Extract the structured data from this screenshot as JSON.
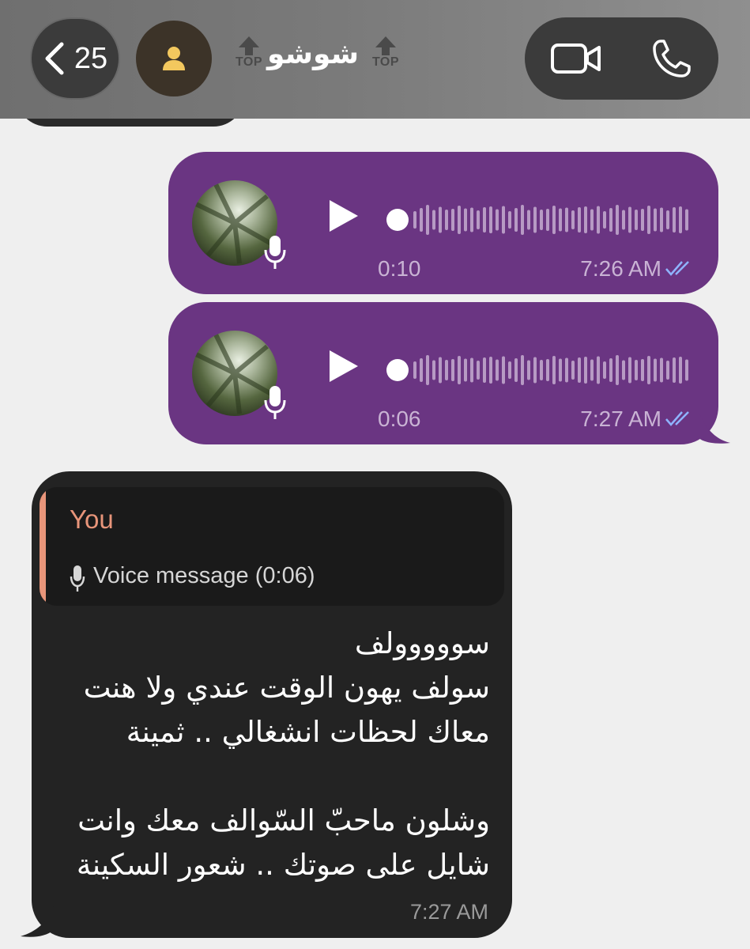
{
  "header": {
    "back_count": "25",
    "contact_name": "شوشو",
    "top_marker_label": "TOP",
    "icons": [
      "chevron-left-icon",
      "person-icon",
      "video-call-icon",
      "phone-icon"
    ]
  },
  "voice_messages": [
    {
      "duration": "0:10",
      "time": "7:26 AM",
      "status": "read"
    },
    {
      "duration": "0:06",
      "time": "7:27 AM",
      "status": "read"
    }
  ],
  "incoming": {
    "reply": {
      "author": "You",
      "preview": "Voice message (0:06)"
    },
    "text": "سووووولف\nسولف يهون الوقت عندي ولا هنت\nمعاك لحظات انشغالي .. ثمينة\n\nوشلون ماحبّ السّوالف معك وانت\nشايل على صوتك .. شعور السكينة",
    "time": "7:27 AM"
  },
  "colors": {
    "outgoing_bubble": "#6a3582",
    "incoming_bubble": "#232323",
    "reply_accent": "#e8957a",
    "read_ticks": "#8fb4ff"
  }
}
